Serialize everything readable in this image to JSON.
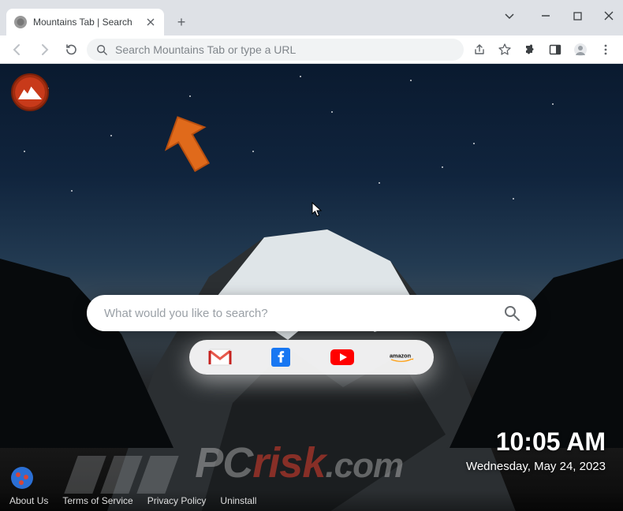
{
  "browser": {
    "tab": {
      "title": "Mountains Tab | Search"
    },
    "omnibox": {
      "placeholder": "Search Mountains Tab or type a URL",
      "value": ""
    },
    "window_controls": {
      "dropdown": "chevron-down",
      "minimize": "minimize",
      "maximize": "maximize",
      "close": "close"
    }
  },
  "extension": {
    "logo_label": "Mountains Tab"
  },
  "search": {
    "placeholder": "What would you like to search?",
    "value": ""
  },
  "shortcuts": [
    {
      "id": "gmail",
      "label": "Gmail"
    },
    {
      "id": "facebook",
      "label": "Facebook"
    },
    {
      "id": "youtube",
      "label": "YouTube"
    },
    {
      "id": "amazon",
      "label": "Amazon"
    }
  ],
  "clock": {
    "time": "10:05 AM",
    "date": "Wednesday, May 24, 2023"
  },
  "footer": {
    "links": [
      {
        "id": "about",
        "label": "About Us"
      },
      {
        "id": "terms",
        "label": "Terms of Service"
      },
      {
        "id": "privacy",
        "label": "Privacy Policy"
      },
      {
        "id": "uninstall",
        "label": "Uninstall"
      }
    ]
  },
  "watermark": {
    "pc": "PC",
    "risk": "risk",
    "com": ".com"
  },
  "colors": {
    "accent": "#d74637",
    "sky_top": "#0a1a2f",
    "sky_mid": "#233b52"
  }
}
